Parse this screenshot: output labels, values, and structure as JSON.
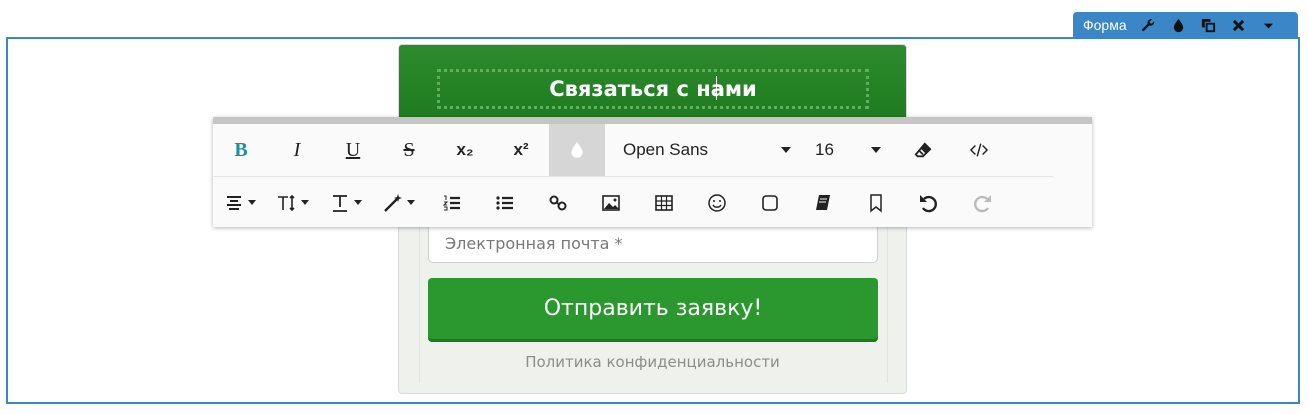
{
  "element_toolbar": {
    "label": "Форма",
    "icons": [
      "wrench-icon",
      "drop-icon",
      "copy-icon",
      "close-icon",
      "caret-down-icon"
    ]
  },
  "form": {
    "title": "Связаться с нами",
    "email_placeholder": "Электронная почта *",
    "submit_label": "Отправить заявку!",
    "privacy_link": "Политика конфиденциальности"
  },
  "editor_toolbar": {
    "bold": "B",
    "italic": "I",
    "underline": "U",
    "strike": "S",
    "subscript": "x₂",
    "superscript": "x²",
    "font_family": "Open Sans",
    "font_size": "16"
  },
  "colors": {
    "accent_blue": "#3a86c6",
    "header_green": "#1f7a1f",
    "button_green": "#2a982e"
  }
}
